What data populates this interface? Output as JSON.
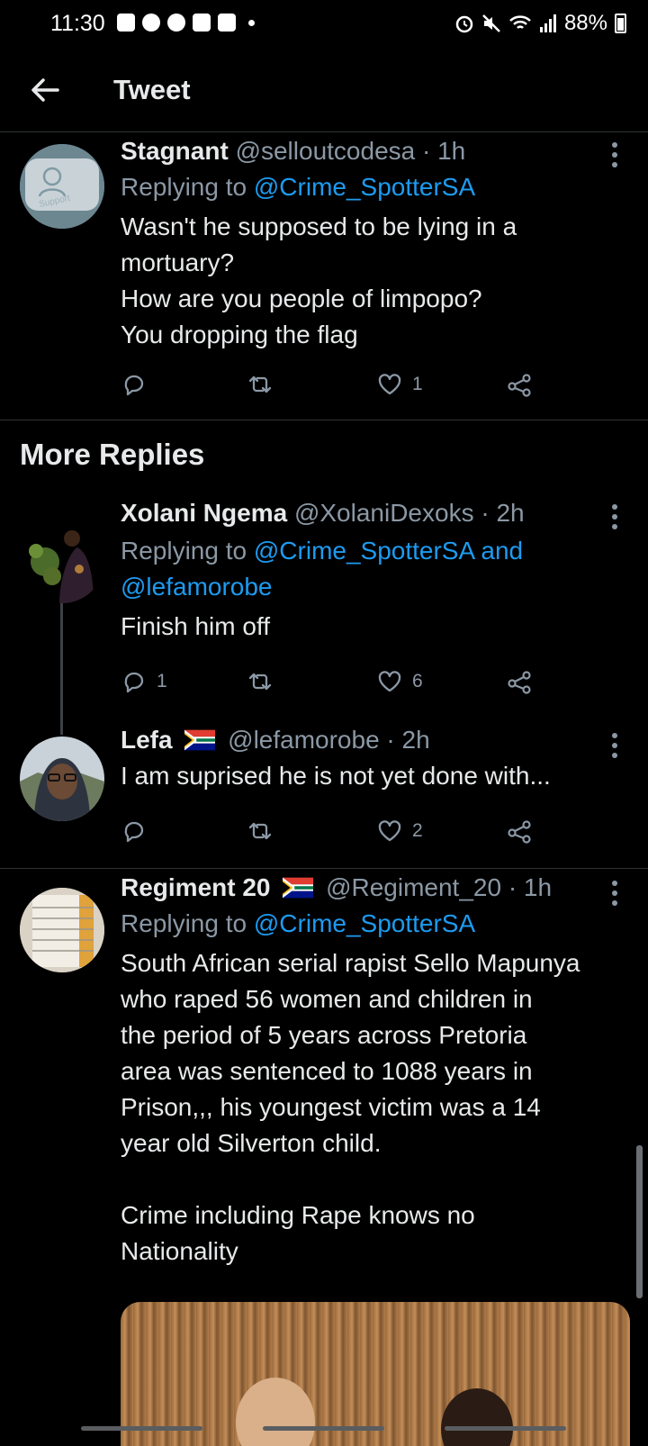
{
  "status_bar": {
    "time": "11:30",
    "battery": "88%"
  },
  "header": {
    "title": "Tweet"
  },
  "tweets": [
    {
      "name": "Stagnant",
      "meta": "@selloutcodesa · 1h",
      "replying_prefix": "Replying to ",
      "replying_to": "@Crime_SpotterSA",
      "body": "Wasn't he supposed to be lying in a\nmortuary?\nHow are you people of limpopo?\nYou dropping the flag",
      "reply_count": "",
      "retweet_count": "",
      "like_count": "1",
      "avatar_text": "Support"
    },
    {
      "name": "Xolani Ngema",
      "meta": "@XolaniDexoks · 2h",
      "replying_prefix": "Replying to ",
      "replying_to": "@Crime_SpotterSA and",
      "replying_to_2": "@lefamorobe",
      "body": "Finish him off",
      "reply_count": "1",
      "retweet_count": "",
      "like_count": "6"
    },
    {
      "name": "Lefa",
      "meta": "@lefamorobe · 2h",
      "body": "I am suprised he is not yet done with...",
      "reply_count": "",
      "retweet_count": "",
      "like_count": "2"
    },
    {
      "name": "Regiment 20",
      "meta": "@Regiment_20 · 1h",
      "replying_prefix": "Replying to ",
      "replying_to": "@Crime_SpotterSA",
      "body": "South African serial rapist Sello Mapunya\nwho raped 56 women and children  in\nthe period of 5 years across Pretoria\narea was sentenced to 1088 years in\nPrison,,, his youngest victim was a 14\nyear old Silverton child.\n\nCrime including Rape knows no\nNationality"
    }
  ],
  "more_replies_label": "More Replies",
  "colors": {
    "background": "#000000",
    "text": "#e7e9ea",
    "muted": "#8b98a5",
    "link": "#1d9bf0",
    "divider": "#2f3336"
  },
  "icons": [
    "back-arrow-icon",
    "reply-icon",
    "retweet-icon",
    "like-icon",
    "share-icon",
    "more-options-icon",
    "south-africa-flag-icon"
  ]
}
